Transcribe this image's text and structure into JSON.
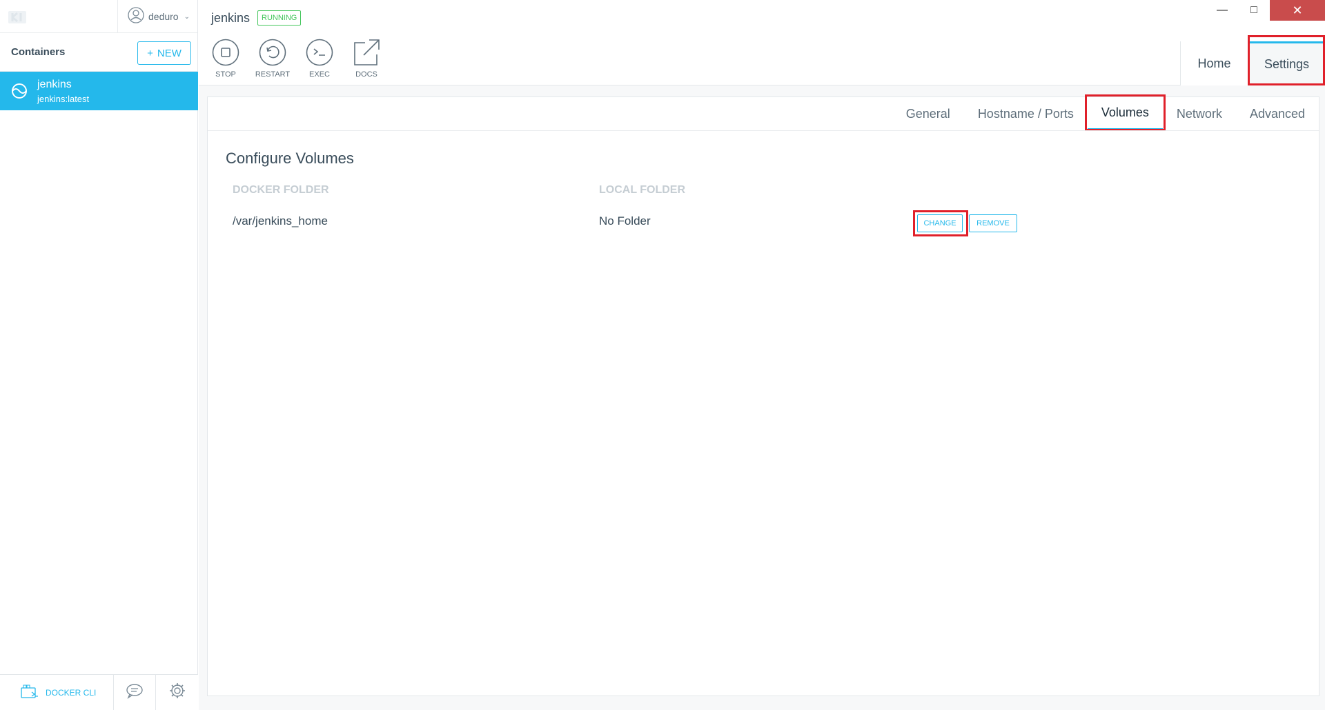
{
  "user": {
    "name": "deduro"
  },
  "sidebar": {
    "title": "Containers",
    "new_label": "NEW",
    "items": [
      {
        "name": "jenkins",
        "image": "jenkins:latest"
      }
    ],
    "footer": {
      "cli_label": "DOCKER CLI"
    }
  },
  "header": {
    "container_name": "jenkins",
    "status": "RUNNING",
    "actions": [
      {
        "label": "STOP",
        "icon": "stop-icon"
      },
      {
        "label": "RESTART",
        "icon": "restart-icon"
      },
      {
        "label": "EXEC",
        "icon": "terminal-icon"
      },
      {
        "label": "DOCS",
        "icon": "external-link-icon"
      }
    ],
    "tabs": [
      {
        "label": "Home"
      },
      {
        "label": "Settings"
      }
    ]
  },
  "settings": {
    "tabs": [
      {
        "label": "General"
      },
      {
        "label": "Hostname / Ports"
      },
      {
        "label": "Volumes"
      },
      {
        "label": "Network"
      },
      {
        "label": "Advanced"
      }
    ],
    "section_title": "Configure Volumes",
    "columns": {
      "docker": "DOCKER FOLDER",
      "local": "LOCAL FOLDER"
    },
    "volumes": [
      {
        "docker_folder": "/var/jenkins_home",
        "local_folder": "No Folder"
      }
    ],
    "buttons": {
      "change": "CHANGE",
      "remove": "REMOVE"
    }
  },
  "colors": {
    "accent": "#24b8eb",
    "running": "#42c55a",
    "highlight": "#e0202a",
    "close": "#c94c4c"
  }
}
